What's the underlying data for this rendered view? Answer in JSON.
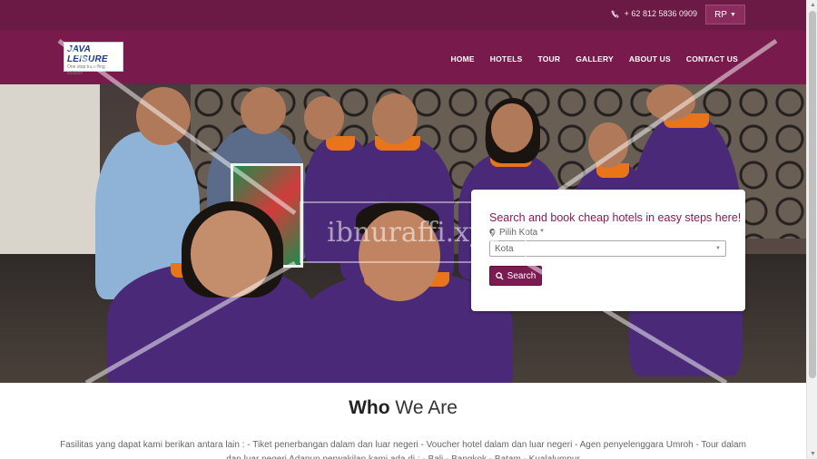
{
  "topbar": {
    "phone": "+ 62 812 5836 0909",
    "currency": "RP"
  },
  "logo": {
    "title": "JAVA LEISURE",
    "tagline": "One stop travelling solution"
  },
  "nav": {
    "items": [
      "HOME",
      "HOTELS",
      "TOUR",
      "GALLERY",
      "ABOUT US",
      "CONTACT US"
    ]
  },
  "search": {
    "heading": "Search and book cheap hotels in easy steps here!",
    "city_label": "Pilih Kota *",
    "city_placeholder": "Kota",
    "button": "Search"
  },
  "watermark": "ibnuraffi.xyz",
  "about": {
    "title_bold": "Who",
    "title_rest": "We Are",
    "text": "Fasilitas yang dapat kami berikan antara lain : - Tiket penerbangan dalam dan luar negeri - Voucher hotel dalam dan luar negeri - Agen penyelenggara Umroh - Tour dalam dan luar negeri Adapun perwakilan kami ada di : - Bali - Bangkok - Batam - Kualalumpur"
  },
  "colors": {
    "brand": "#7d194e",
    "brand_dark": "#6e1946",
    "accent_text": "#8b1a55"
  },
  "icons": {
    "phone": "phone-icon",
    "caret": "caret-down-icon",
    "pin": "map-marker-icon",
    "search": "search-icon"
  }
}
